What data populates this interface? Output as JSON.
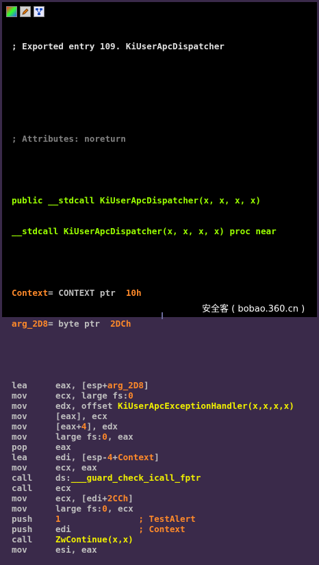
{
  "toolbar": {
    "buttons": [
      {
        "icon": "graph-overview-icon"
      },
      {
        "icon": "edit-pencil-icon"
      },
      {
        "icon": "flowchart-icon"
      }
    ]
  },
  "header": {
    "exported_comment": "; Exported entry 109. KiUserApcDispatcher",
    "attributes_comment": "; Attributes: noreturn",
    "public_decl": "public __stdcall KiUserApcDispatcher(x, x, x, x)",
    "proc_decl": "__stdcall KiUserApcDispatcher(x, x, x, x) proc near"
  },
  "vars": [
    {
      "name": "Context",
      "eq": "= CONTEXT ptr  ",
      "off": "10h"
    },
    {
      "name": "arg_2D8",
      "eq": "= byte ptr  ",
      "off": "2DCh"
    }
  ],
  "lines": [
    {
      "mn": "lea",
      "parts": [
        [
          "gy",
          "eax, [esp+"
        ],
        [
          "or",
          "arg_2D8"
        ],
        [
          "gy",
          "]"
        ]
      ]
    },
    {
      "mn": "mov",
      "parts": [
        [
          "gy",
          "ecx, large fs:"
        ],
        [
          "or",
          "0"
        ]
      ]
    },
    {
      "mn": "mov",
      "parts": [
        [
          "gy",
          "edx, offset "
        ],
        [
          "yl",
          "KiUserApcExceptionHandler(x,x,x,x)"
        ]
      ]
    },
    {
      "mn": "mov",
      "parts": [
        [
          "gy",
          "[eax], ecx"
        ]
      ]
    },
    {
      "mn": "mov",
      "parts": [
        [
          "gy",
          "[eax+"
        ],
        [
          "or",
          "4"
        ],
        [
          "gy",
          "], edx"
        ]
      ]
    },
    {
      "mn": "mov",
      "parts": [
        [
          "gy",
          "large fs:"
        ],
        [
          "or",
          "0"
        ],
        [
          "gy",
          ", eax"
        ]
      ]
    },
    {
      "mn": "pop",
      "parts": [
        [
          "gy",
          "eax"
        ]
      ]
    },
    {
      "mn": "lea",
      "parts": [
        [
          "gy",
          "edi, [esp-"
        ],
        [
          "or",
          "4"
        ],
        [
          "gy",
          "+"
        ],
        [
          "or",
          "Context"
        ],
        [
          "gy",
          "]"
        ]
      ]
    },
    {
      "mn": "mov",
      "parts": [
        [
          "gy",
          "ecx, eax"
        ]
      ]
    },
    {
      "mn": "call",
      "parts": [
        [
          "gy",
          "ds:"
        ],
        [
          "yl",
          "___guard_check_icall_fptr"
        ]
      ]
    },
    {
      "mn": "call",
      "parts": [
        [
          "gy",
          "ecx"
        ]
      ]
    },
    {
      "mn": "mov",
      "parts": [
        [
          "gy",
          "ecx, [edi+"
        ],
        [
          "or",
          "2CCh"
        ],
        [
          "gy",
          "]"
        ]
      ]
    },
    {
      "mn": "mov",
      "parts": [
        [
          "gy",
          "large fs:"
        ],
        [
          "or",
          "0"
        ],
        [
          "gy",
          ", ecx"
        ]
      ]
    },
    {
      "mn": "push",
      "parts": [
        [
          "or",
          "1"
        ],
        [
          "gy",
          "               "
        ],
        [
          "or",
          "; TestAlert"
        ]
      ]
    },
    {
      "mn": "push",
      "parts": [
        [
          "gy",
          "edi"
        ],
        [
          "gy",
          "             "
        ],
        [
          "or",
          "; Context"
        ]
      ]
    },
    {
      "mn": "call",
      "parts": [
        [
          "yl",
          "ZwContinue(x,x)"
        ]
      ]
    },
    {
      "mn": "mov",
      "parts": [
        [
          "gy",
          "esi, eax"
        ]
      ]
    }
  ],
  "watermark": "安全客 ( bobao.360.cn )"
}
